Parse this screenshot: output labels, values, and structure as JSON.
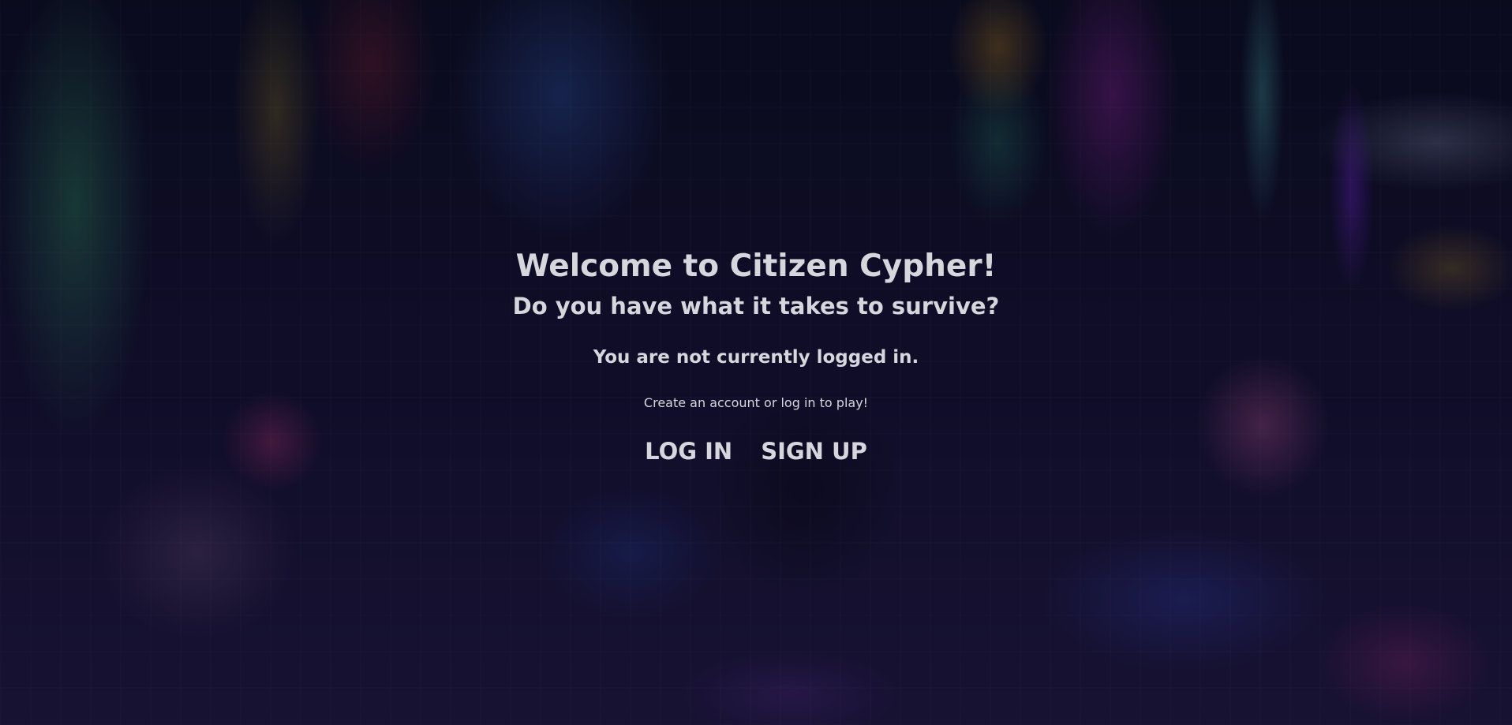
{
  "hero": {
    "title": "Welcome to Citizen Cypher!",
    "subtitle": "Do you have what it takes to survive?",
    "status": "You are not currently logged in.",
    "hint": "Create an account or log in to play!"
  },
  "actions": {
    "login_label": "LOG IN",
    "signup_label": "SIGN UP"
  },
  "colors": {
    "text": "#d6d6dc",
    "background": "#0a0b1e"
  }
}
